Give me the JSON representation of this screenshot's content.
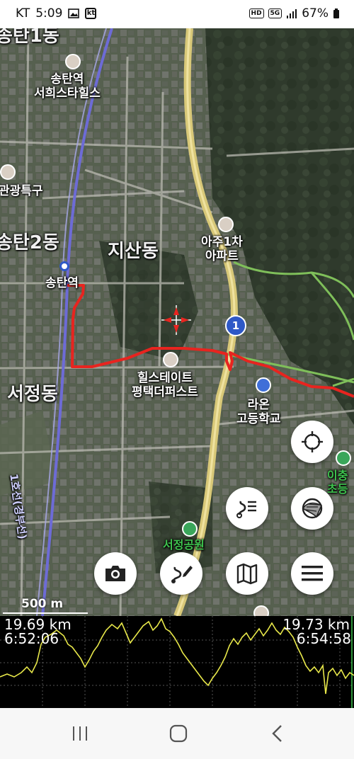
{
  "status_bar": {
    "carrier": "KT",
    "time": "5:09",
    "kt_badge": "kt",
    "hd_badge": "HD",
    "network": "5G",
    "battery": "67%"
  },
  "map": {
    "labels": [
      {
        "id": "songtan-1dong",
        "text": "송탄1동"
      },
      {
        "id": "songtan-station-hills",
        "text": "송탄역\n서희스타힐스"
      },
      {
        "id": "tourism-zone",
        "text": "관광특구"
      },
      {
        "id": "songtan-2dong",
        "text": "송탄2동"
      },
      {
        "id": "jisan-dong",
        "text": "지산동"
      },
      {
        "id": "aju-apt",
        "text": "아주1차\n아파트"
      },
      {
        "id": "songtan-station",
        "text": "송탄역"
      },
      {
        "id": "hillstate",
        "text": "힐스테이트\n평택더퍼스트"
      },
      {
        "id": "seojeong-dong",
        "text": "서정동"
      },
      {
        "id": "raon-high",
        "text": "라온\n고등학교"
      },
      {
        "id": "line1",
        "text": "1호선(경부선)"
      },
      {
        "id": "ichung",
        "text": "이충\n초등"
      },
      {
        "id": "seojeong-park",
        "text": "서정공원"
      }
    ],
    "route_badge": "1",
    "scale": "500 m"
  },
  "buttons": {
    "locate": "locate-icon",
    "route_list": "route-list-icon",
    "map_layers": "map-layer-icon",
    "camera": "camera-icon",
    "draw_route": "draw-route-icon",
    "map": "map-icon",
    "menu": "menu-icon"
  },
  "elevation_graph": {
    "left_distance": "19.69 km",
    "left_time": "6:52:06",
    "right_distance": "19.73 km",
    "right_time": "6:54:58"
  },
  "nav_bar": {
    "recents": "recents-icon",
    "home": "home-icon",
    "back": "back-icon"
  },
  "colors": {
    "track": "#e8241f",
    "trail": "#7fbf5a",
    "highway": "#d8c878",
    "graph_line": "#e8e84a"
  }
}
